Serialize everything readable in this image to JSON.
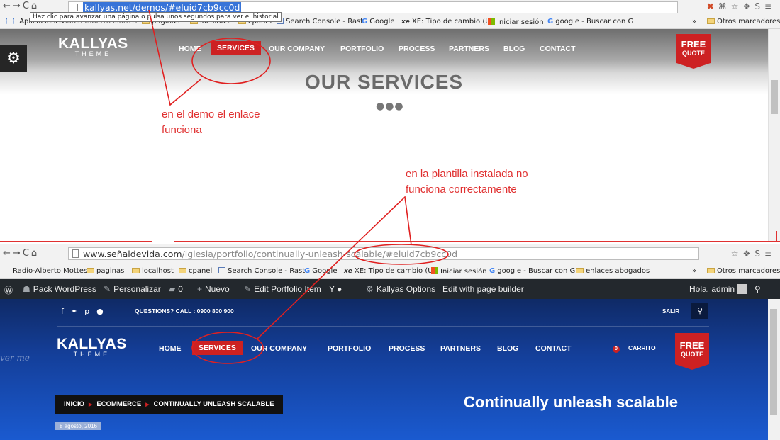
{
  "browser1": {
    "url": "kallyas.net/demos/#eluid7cb9cc0d",
    "tooltip": "Haz clic para avanzar una página o pulsa unos segundos para ver el historial",
    "bookmarks": [
      "Aplicaciones",
      "Radio-Alberto Mottes",
      "paginas",
      "localhost",
      "cpanel",
      "Search Console - Rast",
      "Google",
      "XE: Tipo de cambio (U",
      "Iniciar sesión",
      "google - Buscar con G",
      "Otros marcadores"
    ]
  },
  "demo": {
    "logo": "KALLYAS",
    "logo_sub": "THEME",
    "menu": [
      "HOME",
      "SERVICES",
      "OUR COMPANY",
      "PORTFOLIO",
      "PROCESS",
      "PARTNERS",
      "BLOG",
      "CONTACT"
    ],
    "badge_line1": "FREE",
    "badge_line2": "QUOTE",
    "section_title": "OUR SERVICES"
  },
  "annotations": {
    "demo_note": [
      "en el demo el enlace",
      "funciona"
    ],
    "installed_note": [
      "en la plantilla instalada no",
      "funciona correctamente"
    ]
  },
  "browser2": {
    "url_domain": "www.señaldevida.com",
    "url_path": "/iglesia/portfolio/continually-unleash-scalable/",
    "url_hash": "#eluid7cb9cc0d",
    "bookmarks": [
      "Radio-Alberto Mottes",
      "paginas",
      "localhost",
      "cpanel",
      "Search Console - Rast",
      "Google",
      "XE: Tipo de cambio (U",
      "Iniciar sesión",
      "google - Buscar con G",
      "enlaces abogados",
      "Otros marcadores"
    ]
  },
  "wpbar": {
    "pack": "Pack WordPress",
    "customize": "Personalizar",
    "comments": "0",
    "new": "Nuevo",
    "edit": "Edit Portfolio Item",
    "kallyas": "Kallyas Options",
    "builder": "Edit with page builder",
    "greeting": "Hola, admin"
  },
  "site2": {
    "questions": "QUESTIONS? CALL : 0900 800 900",
    "salir": "SALIR",
    "follow": "ver me",
    "logo": "KALLYAS",
    "logo_sub": "THEME",
    "menu": [
      "HOME",
      "SERVICES",
      "OUR COMPANY",
      "PORTFOLIO",
      "PROCESS",
      "PARTNERS",
      "BLOG",
      "CONTACT"
    ],
    "cart_count": "0",
    "cart": "CARRITO",
    "badge_line1": "FREE",
    "badge_line2": "QUOTE",
    "breadcrumb": [
      "INICIO",
      "ECOMMERCE",
      "CONTINUALLY UNLEASH SCALABLE"
    ],
    "page_title": "Continually unleash scalable",
    "date": "8 agosto, 2016"
  }
}
